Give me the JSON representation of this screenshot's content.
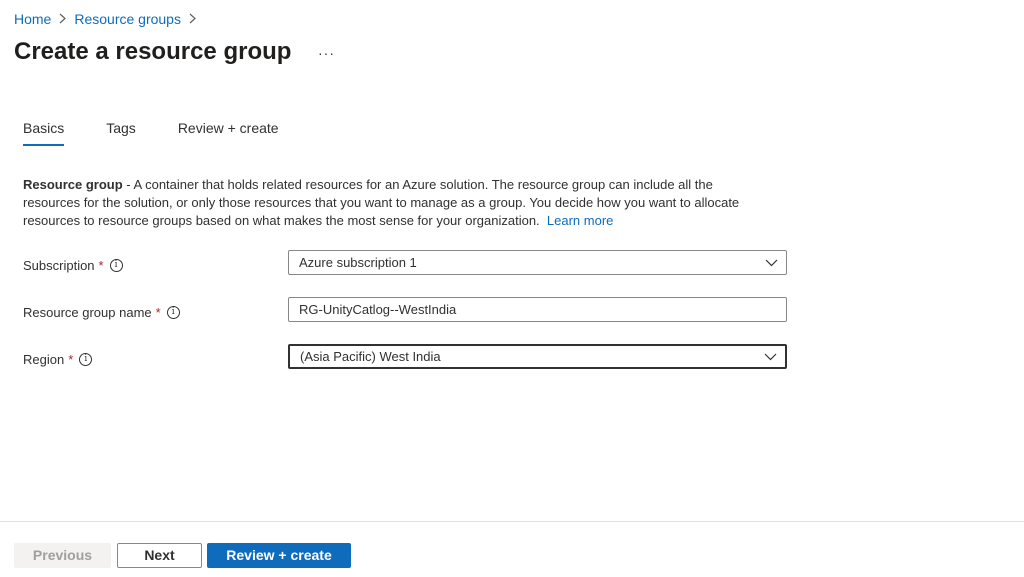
{
  "breadcrumb": {
    "items": [
      "Home",
      "Resource groups"
    ]
  },
  "page": {
    "title": "Create a resource group",
    "more": "···"
  },
  "tabs": [
    {
      "label": "Basics",
      "active": true
    },
    {
      "label": "Tags",
      "active": false
    },
    {
      "label": "Review + create",
      "active": false
    }
  ],
  "description": {
    "term": "Resource group",
    "text": " - A container that holds related resources for an Azure solution. The resource group can include all the resources for the solution, or only those resources that you want to manage as a group. You decide how you want to allocate resources to resource groups based on what makes the most sense for your organization.",
    "link": "Learn more"
  },
  "form": {
    "subscription": {
      "label": "Subscription",
      "required": "*",
      "value": "Azure subscription 1"
    },
    "name": {
      "label": "Resource group name",
      "required": "*",
      "value": "RG-UnityCatlog--WestIndia"
    },
    "region": {
      "label": "Region",
      "required": "*",
      "value": "(Asia Pacific) West India"
    },
    "info_glyph": "i"
  },
  "footer": {
    "previous": "Previous",
    "next": "Next",
    "create": "Review + create"
  },
  "colors": {
    "accent": "#0f6cbd",
    "required": "#a4262c",
    "text": "#323130"
  }
}
